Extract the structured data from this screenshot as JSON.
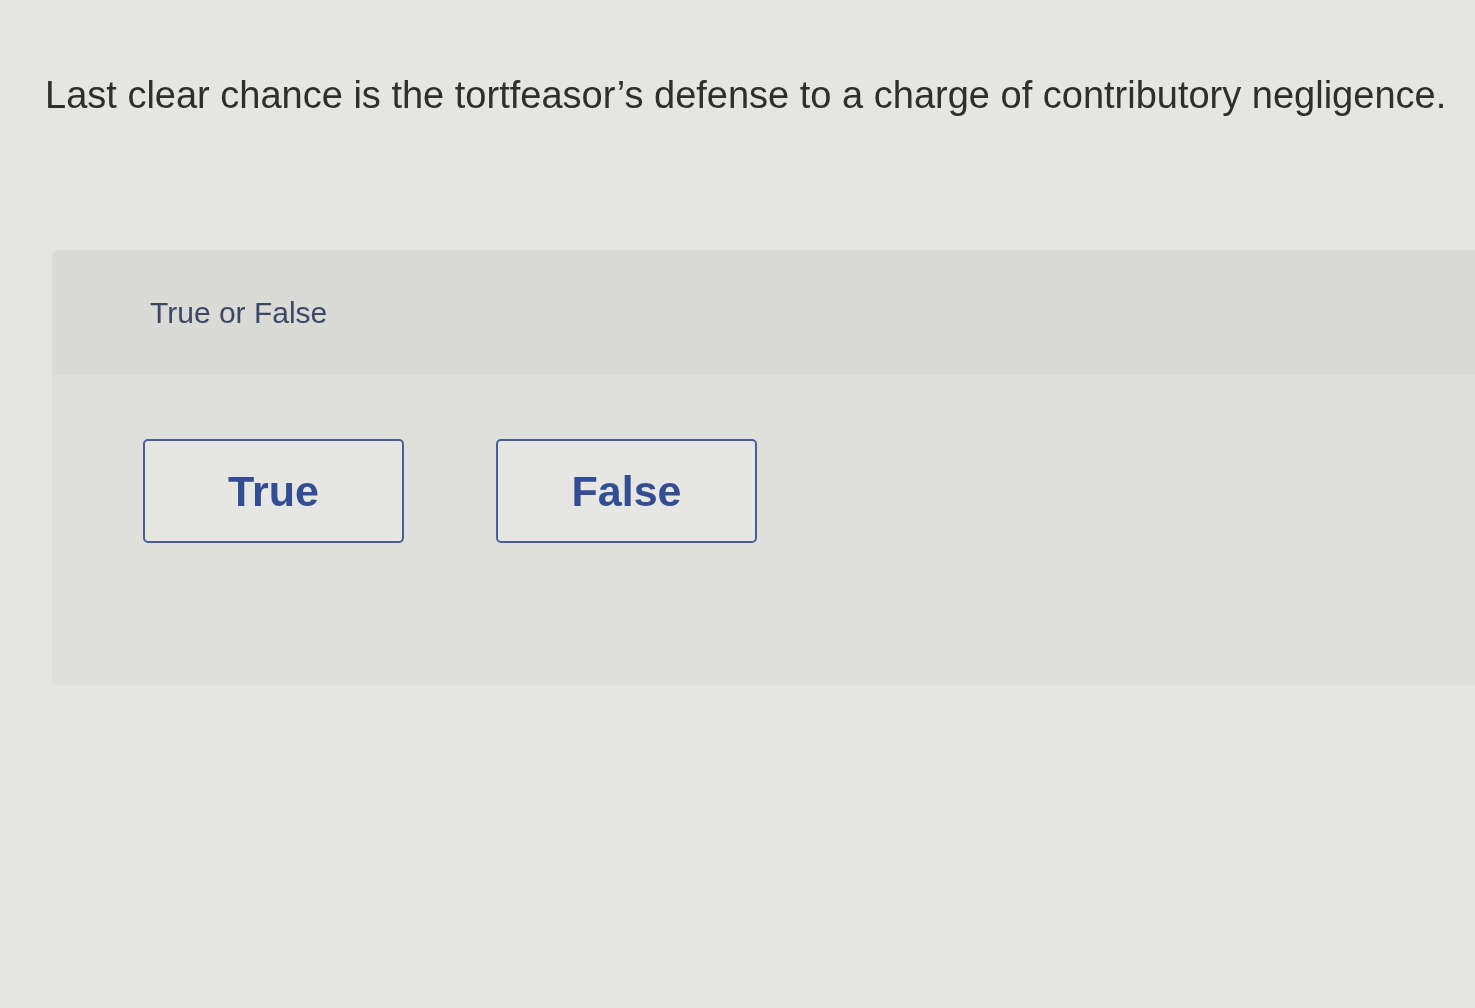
{
  "question": {
    "text": "Last clear chance is the tortfeasor’s defense to a charge of contributory negligence."
  },
  "answer_panel": {
    "prompt_label": "True or False",
    "options": [
      {
        "label": "True"
      },
      {
        "label": "False"
      }
    ]
  }
}
